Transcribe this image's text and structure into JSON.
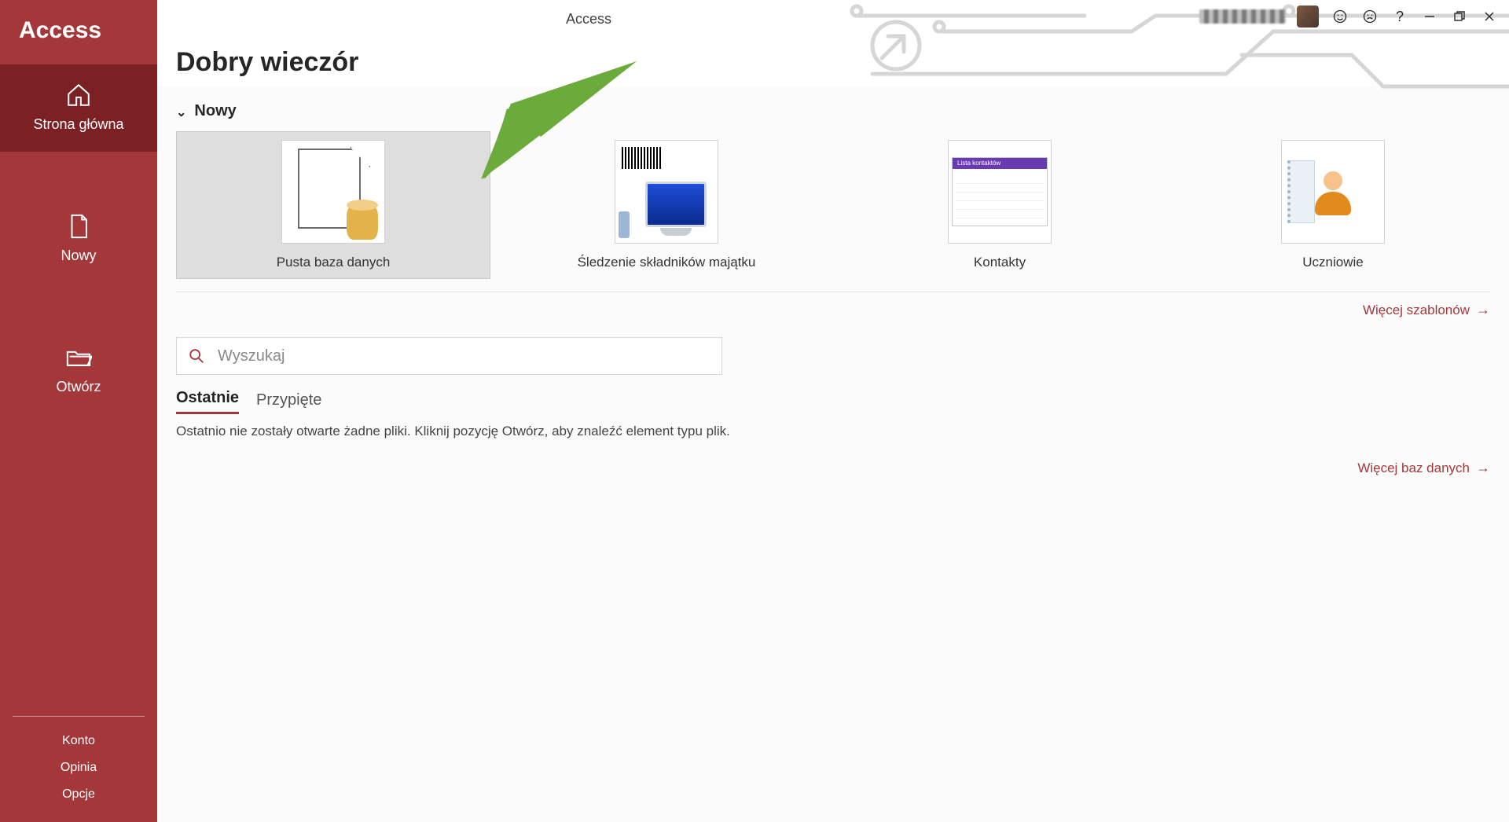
{
  "app": {
    "title": "Access",
    "name": "Access"
  },
  "sidebar": {
    "items": [
      {
        "label": "Strona główna"
      },
      {
        "label": "Nowy"
      },
      {
        "label": "Otwórz"
      }
    ],
    "bottom": [
      {
        "label": "Konto"
      },
      {
        "label": "Opinia"
      },
      {
        "label": "Opcje"
      }
    ]
  },
  "main": {
    "greeting": "Dobry wieczór",
    "new_section": "Nowy",
    "templates": [
      {
        "label": "Pusta baza danych"
      },
      {
        "label": "Śledzenie składników majątku"
      },
      {
        "label": "Kontakty"
      },
      {
        "label": "Uczniowie"
      }
    ],
    "more_templates": "Więcej szablonów",
    "search_placeholder": "Wyszukaj",
    "tabs": [
      {
        "label": "Ostatnie"
      },
      {
        "label": "Przypięte"
      }
    ],
    "empty_recent": "Ostatnio nie zostały otwarte żadne pliki. Kliknij pozycję Otwórz, aby znaleźć element typu plik.",
    "more_databases": "Więcej baz danych",
    "contacts_title": "Lista kontaktów"
  }
}
